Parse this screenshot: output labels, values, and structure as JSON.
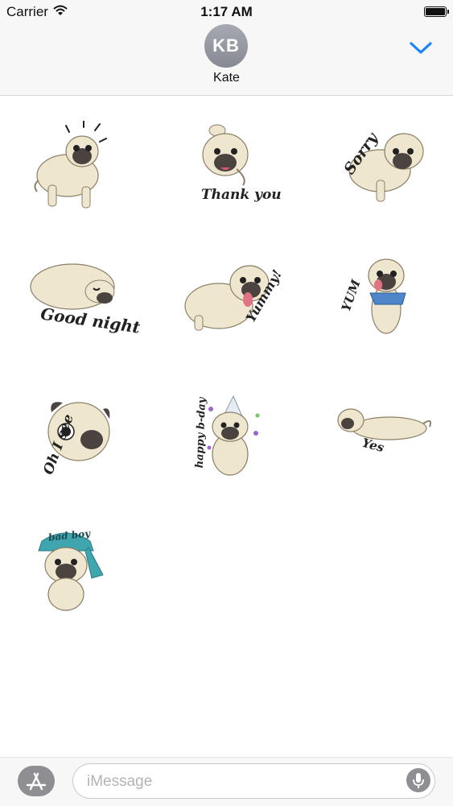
{
  "status_bar": {
    "carrier": "Carrier",
    "time": "1:17 AM"
  },
  "header": {
    "avatar_initials": "KB",
    "contact_name": "Kate"
  },
  "stickers": [
    {
      "name": "pug-surprised",
      "caption": ""
    },
    {
      "name": "pug-thank-you",
      "caption": "Thank you"
    },
    {
      "name": "pug-sorry",
      "caption": "Sorry"
    },
    {
      "name": "pug-good-night",
      "caption": "Good night"
    },
    {
      "name": "pug-yummy",
      "caption": "Yummy!"
    },
    {
      "name": "pug-yum",
      "caption": "YUM"
    },
    {
      "name": "pug-oh-i-see",
      "caption": "Oh I see"
    },
    {
      "name": "pug-happy-b-day",
      "caption": "happy b-day"
    },
    {
      "name": "pug-yes",
      "caption": "Yes"
    },
    {
      "name": "pug-bad-boy",
      "caption": "bad boy"
    }
  ],
  "compose": {
    "placeholder": "iMessage"
  },
  "icons": {
    "wifi": "wifi-icon",
    "battery": "battery-icon",
    "collapse": "chevron-down-icon",
    "app_store": "app-store-icon",
    "mic": "microphone-icon"
  },
  "colors": {
    "accent": "#1a82fb",
    "pug_body": "#efe6cf",
    "pug_mask": "#4a4340"
  }
}
